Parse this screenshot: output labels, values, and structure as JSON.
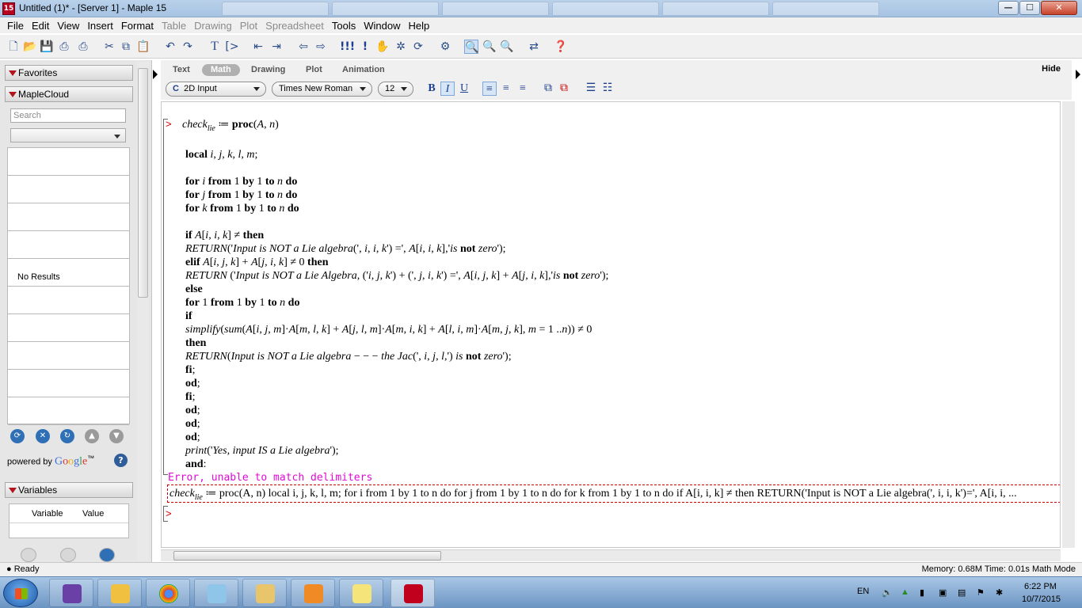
{
  "window": {
    "title": "Untitled (1)* - [Server 1] - Maple 15",
    "app_icon_text": "15",
    "minimize": "—",
    "maximize": "☐",
    "close": "✕"
  },
  "menu": [
    {
      "label": "File",
      "enabled": true
    },
    {
      "label": "Edit",
      "enabled": true
    },
    {
      "label": "View",
      "enabled": true
    },
    {
      "label": "Insert",
      "enabled": true
    },
    {
      "label": "Format",
      "enabled": true
    },
    {
      "label": "Table",
      "enabled": false
    },
    {
      "label": "Drawing",
      "enabled": false
    },
    {
      "label": "Plot",
      "enabled": false
    },
    {
      "label": "Spreadsheet",
      "enabled": false
    },
    {
      "label": "Tools",
      "enabled": true
    },
    {
      "label": "Window",
      "enabled": true
    },
    {
      "label": "Help",
      "enabled": true
    }
  ],
  "left_panel": {
    "favorites_label": "Favorites",
    "maplecloud_label": "MapleCloud",
    "search_placeholder": "Search",
    "no_results": "No Results",
    "powered_by": "powered by",
    "google": "Google",
    "google_tm": "™",
    "help_glyph": "?",
    "variables_label": "Variables",
    "variable_col": "Variable",
    "value_col": "Value"
  },
  "context_bar": {
    "tabs": [
      "Text",
      "Math",
      "Drawing",
      "Plot",
      "Animation"
    ],
    "active_tab": "Math",
    "hide_label": "Hide",
    "input_mode": "2D Input",
    "input_mode_prefix": "C",
    "font": "Times New Roman",
    "size": "12",
    "bold": "B",
    "italic": "I",
    "underline": "U"
  },
  "worksheet": {
    "prompt": ">",
    "error_message": "Error, unable to match delimiters",
    "echo_text": "≔ proc(A, n)  local i, j, k, l, m;   for i from 1 by 1 to n do for j from 1 by 1 to n do for k from 1 by 1 to n do  if A[i, i, k] ≠ then RETURN('Input is NOT a Lie algebra(', i, i, k')=', A[i, i, ..."
  },
  "status_bar": {
    "ready": "Ready",
    "right": "Memory: 0.68M  Time: 0.01s  Math Mode"
  },
  "taskbar": {
    "lang": "EN",
    "time": "6:22 PM",
    "date": "10/7/2015"
  },
  "colors": {
    "prompt": "#d40000",
    "error": "#e20ad6",
    "echo_border": "#d00000"
  }
}
